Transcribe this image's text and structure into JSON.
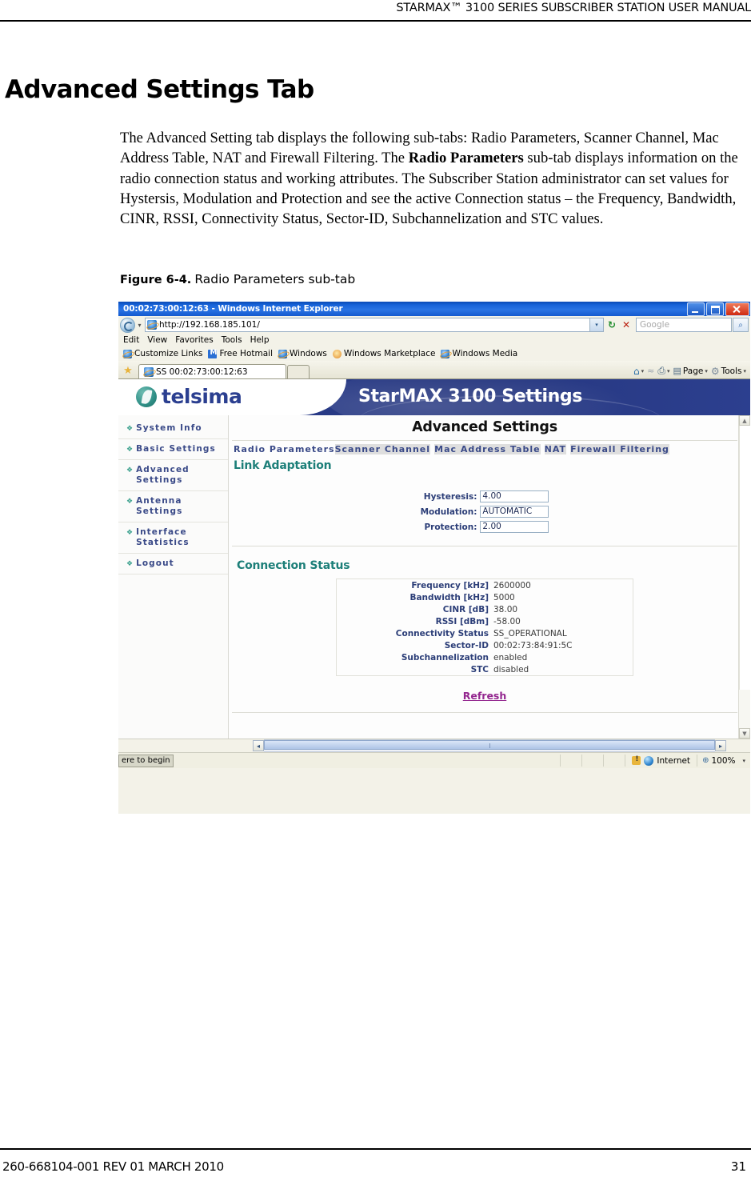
{
  "document": {
    "running_head": "STARMAX™ 3100 SERIES SUBSCRIBER STATION USER MANUAL",
    "title": "Advanced Settings Tab",
    "paragraph_html": "The Advanced Setting tab displays the following sub-tabs: Radio Parameters, Scanner Channel, Mac Address Table, NAT and Firewall Filtering. The <b>Radio Parameters</b> sub-tab displays information on the radio connection status and working attributes. The Subscriber Station administrator can set values for Hystersis, Modulation and Protection and see the active Connection status – the Frequency, Bandwidth, CINR, RSSI, Connectivity Status, Sector-ID, Subchannelization and STC values.",
    "figure_number": "Figure 6-4.",
    "figure_caption": "Radio Parameters sub-tab",
    "footer_left": "260-668104-001 REV 01 MARCH 2010",
    "page_number": "31"
  },
  "browser": {
    "window_title": "00:02:73:00:12:63 - Windows Internet Explorer",
    "address": {
      "url": "http://192.168.185.101/",
      "refresh_glyph": "↻",
      "stop_glyph": "✕"
    },
    "search": {
      "placeholder": "Google",
      "go_glyph": "⌕"
    },
    "menu": [
      "Edit",
      "View",
      "Favorites",
      "Tools",
      "Help"
    ],
    "links": [
      "Customize Links",
      "Free Hotmail",
      "Windows",
      "Windows Marketplace",
      "Windows Media"
    ],
    "tab": {
      "label": "SS 00:02:73:00:12:63"
    },
    "toolbar": {
      "home_glyph": "⌂",
      "rss_glyph": "≈",
      "print_glyph": "⎙",
      "page_label": "Page",
      "tools_label": "Tools",
      "caret": "▾"
    },
    "statusbar": {
      "start_text": "ere to begin",
      "zone": "Internet",
      "zoom": "100%",
      "caret": "▾"
    }
  },
  "site": {
    "brand": "telsima",
    "banner_title": "StarMAX 3100 Settings",
    "sidebar": [
      {
        "label": "System Info"
      },
      {
        "label": "Basic Settings"
      },
      {
        "label": "Advanced Settings"
      },
      {
        "label": "Antenna Settings"
      },
      {
        "label": "Interface Statistics"
      },
      {
        "label": "Logout"
      }
    ],
    "page_heading": "Advanced Settings",
    "subtabs": [
      {
        "label": "Radio Parameters",
        "selected": true
      },
      {
        "label": "Scanner Channel",
        "selected": false
      },
      {
        "label": "Mac Address Table",
        "selected": false
      },
      {
        "label": "NAT",
        "selected": false
      },
      {
        "label": "Firewall Filtering",
        "selected": false
      }
    ],
    "link_adaptation": {
      "heading": "Link Adaptation",
      "fields": [
        {
          "label": "Hysteresis:",
          "value": "4.00"
        },
        {
          "label": "Modulation:",
          "value": "AUTOMATIC"
        },
        {
          "label": "Protection:",
          "value": "2.00"
        }
      ]
    },
    "connection_status": {
      "heading": "Connection Status",
      "rows": [
        {
          "key": "Frequency [kHz]",
          "value": "2600000"
        },
        {
          "key": "Bandwidth [kHz]",
          "value": "5000"
        },
        {
          "key": "CINR [dB]",
          "value": "38.00"
        },
        {
          "key": "RSSI [dBm]",
          "value": "-58.00"
        },
        {
          "key": "Connectivity Status",
          "value": "SS_OPERATIONAL"
        },
        {
          "key": "Sector-ID",
          "value": "00:02:73:84:91:5C"
        },
        {
          "key": "Subchannelization",
          "value": "enabled"
        },
        {
          "key": "STC",
          "value": "disabled"
        }
      ],
      "refresh_label": "Refresh"
    }
  },
  "colors": {
    "brand_blue": "#2b3f90",
    "banner_blue": "#26377f",
    "teal": "#1d7f79",
    "nav_blue": "#3a4a88",
    "refresh_magenta": "#94278f"
  }
}
